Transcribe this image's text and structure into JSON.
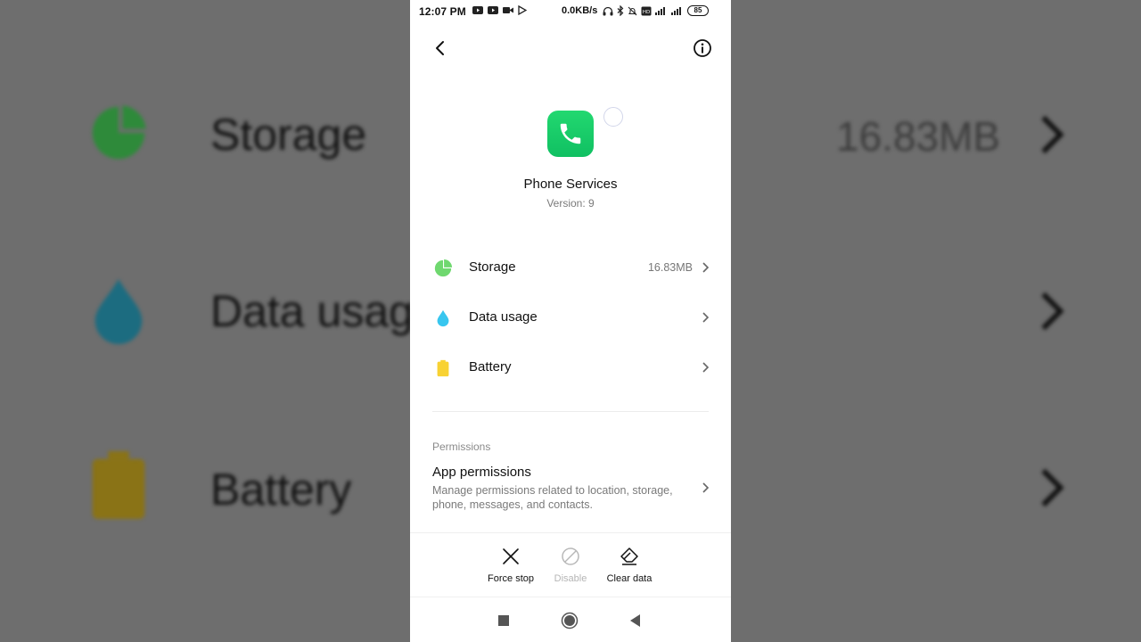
{
  "status_bar": {
    "time": "12:07 PM",
    "net_speed": "0.0KB/s",
    "battery_level": "85",
    "left_icons": [
      "youtube-icon",
      "youtube-icon",
      "video-camera-icon",
      "play-store-icon"
    ],
    "right_icons": [
      "headphones-icon",
      "bluetooth-icon",
      "alarm-off-icon",
      "vowifi-icon",
      "signal-icon",
      "signal-icon"
    ]
  },
  "app": {
    "name": "Phone Services",
    "version": "Version: 9",
    "icon": "phone-icon",
    "icon_color": "#1bcd6a"
  },
  "rows": [
    {
      "label": "Storage",
      "value": "16.83MB",
      "icon": "pie-chart-icon",
      "color": "#6fd86f"
    },
    {
      "label": "Data usage",
      "value": "",
      "icon": "droplet-icon",
      "color": "#38c6ef"
    },
    {
      "label": "Battery",
      "value": "",
      "icon": "battery-icon",
      "color": "#f8d233"
    }
  ],
  "permissions": {
    "section_title": "Permissions",
    "title": "App permissions",
    "description": "Manage permissions related to location, storage, phone, messages, and contacts."
  },
  "actions": {
    "force_stop": "Force stop",
    "disable": "Disable",
    "clear_data": "Clear data"
  },
  "navigation": [
    "recents-square-icon",
    "home-circle-icon",
    "back-triangle-icon"
  ]
}
